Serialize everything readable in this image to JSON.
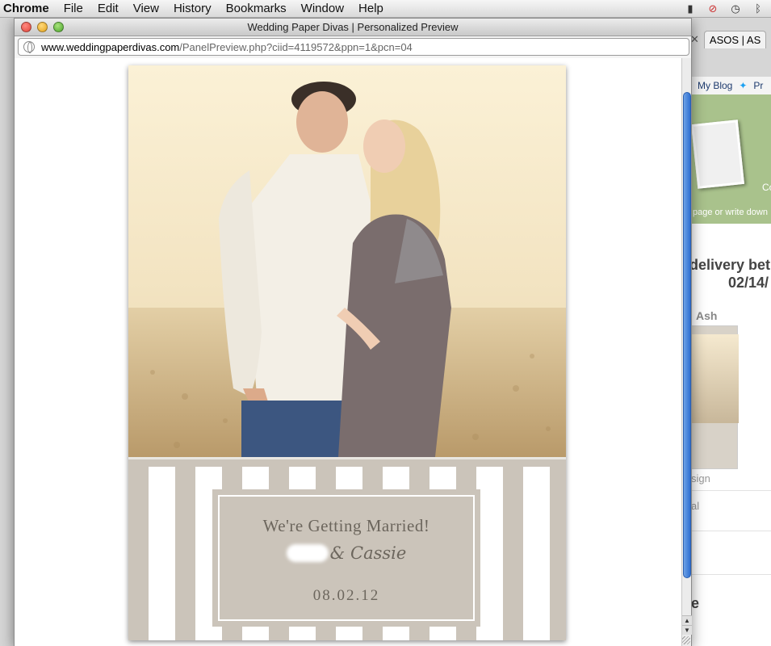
{
  "menubar": {
    "app": "Chrome",
    "items": [
      "File",
      "Edit",
      "View",
      "History",
      "Bookmarks",
      "Window",
      "Help"
    ],
    "status_icons": [
      "battery-icon",
      "stop-icon",
      "time-machine-icon",
      "bluetooth-icon"
    ]
  },
  "background_window": {
    "tabs": [
      "ASOS | AS"
    ],
    "links": [
      "My Blog",
      "Pr"
    ],
    "banner_text": "page or write down",
    "banner_cut": "Co",
    "delivery_line1": "delivery bet",
    "delivery_line2": "02/14/",
    "section": "Ash",
    "sign": "sign",
    "al": "al",
    "e": "e"
  },
  "popup": {
    "title": "Wedding Paper Divas | Personalized Preview",
    "url_host": "www.weddingpaperdivas.com",
    "url_path": "/PanelPreview.php?ciid=4119572&ppn=1&pcn=04"
  },
  "card": {
    "heading": "We're Getting Married!",
    "names": "& Cassie",
    "date": "08.02.12"
  },
  "colors": {
    "card_taupe": "#cbc4ba",
    "card_text": "#6c665d",
    "scroll_blue": "#3b7bd8"
  }
}
